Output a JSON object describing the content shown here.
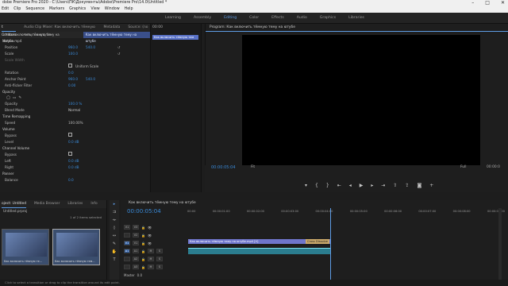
{
  "window": {
    "title": "dobe Premiere Pro 2020 - C:\\Users\\ПК\\Документы\\Adobe\\Premiere Pro\\14.0\\Untitled *"
  },
  "menu": [
    "Edit",
    "Clip",
    "Sequence",
    "Markers",
    "Graphics",
    "View",
    "Window",
    "Help"
  ],
  "workspaces": [
    "Learning",
    "Assembly",
    "Editing",
    "Color",
    "Effects",
    "Audio",
    "Graphics",
    "Libraries"
  ],
  "effect_controls": {
    "tabs": [
      "t Controls",
      "Audio Clip Mixer: Как включить тёмную тему на ютубе",
      "Metadata",
      "Source: (no clips)"
    ],
    "clip_path": "r * Как включить тёмную тему на ютубе.mp4",
    "clip_name": "Как включить тёмную тему на ютубе",
    "motion": "Motion",
    "props": [
      {
        "label": "Position",
        "v1": "960.0",
        "v2": "540.0"
      },
      {
        "label": "Scale",
        "v1": "100.0",
        "v2": ""
      },
      {
        "label": "Scale Width",
        "v1": "",
        "v2": ""
      },
      {
        "label": "",
        "v1": "",
        "v2": "Uniform Scale"
      },
      {
        "label": "Rotation",
        "v1": "0.0",
        "v2": ""
      },
      {
        "label": "Anchor Point",
        "v1": "960.0",
        "v2": "540.0"
      },
      {
        "label": "Anti-flicker Filter",
        "v1": "0.00",
        "v2": ""
      }
    ],
    "opacity_section": "Opacity",
    "opacity": {
      "label": "Opacity",
      "value": "100.0 %"
    },
    "blend": {
      "label": "Blend Mode",
      "value": "Normal"
    },
    "time_section": "Time Remapping",
    "speed": {
      "label": "Speed",
      "value": "100.00%"
    },
    "volume_section": "Volume",
    "bypass": "Bypass",
    "level": {
      "label": "Level",
      "value": "0.0 dB"
    },
    "channel_section": "Channel Volume",
    "left": {
      "label": "Left",
      "value": "0.0 dB"
    },
    "right": {
      "label": "Right",
      "value": "0.0 dB"
    },
    "panner_section": "Panner",
    "balance": {
      "label": "Balance",
      "value": "0.0"
    },
    "mini_time": "00:00",
    "mini_clip": "Как включить тёмную тем"
  },
  "program": {
    "title": "Program: Как включить тёмную тему на ютубе",
    "timecode": "00:00:05:04",
    "fit": "Fit",
    "resolution": "Full",
    "duration": "00:00:0"
  },
  "project": {
    "tabs": [
      "oject: Untitled",
      "Media Browser",
      "Libraries",
      "Info"
    ],
    "path": "Untitled.prproj",
    "selection": "1 of 2 items selected",
    "items": [
      {
        "caption": "Как включить тёмную те..."
      },
      {
        "caption": "Как включить тёмную тем..."
      }
    ]
  },
  "timeline": {
    "title": "Как включить тёмную тему на ютубе",
    "timecode": "00:00:05:04",
    "ruler": [
      "00:00",
      "00:00:01:00",
      "00:00:02:00",
      "00:00:03:00",
      "00:00:04:00",
      "00:00:05:00",
      "00:00:06:00",
      "00:00:07:00",
      "00:00:08:00",
      "00:00:09:00"
    ],
    "video_tracks": [
      "V3",
      "V2",
      "V1"
    ],
    "audio_tracks": [
      "A1",
      "A2",
      "A3"
    ],
    "master": "Master",
    "master_value": "0.0",
    "vclip": "Как включить тёмную тему на ютубе.mp4 [V]",
    "vclip_fx": "Cross Dissolve"
  },
  "status": "Click to select a transition or drag to clip the transition around its edit point.",
  "colors": {
    "accent": "#5e9de6",
    "video_clip": "#6f76cc",
    "audio_clip": "#2b7d8f"
  }
}
